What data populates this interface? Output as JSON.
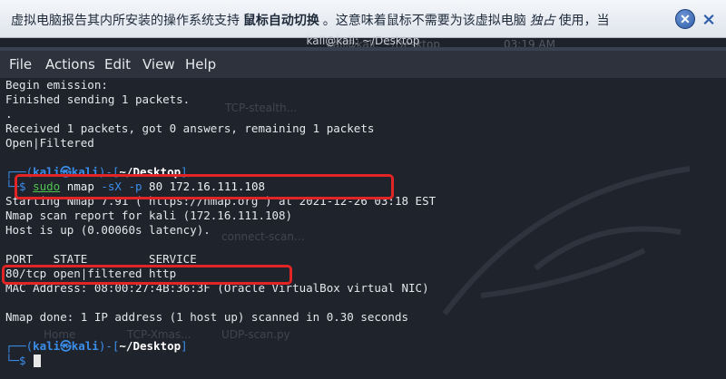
{
  "notification": {
    "text_pre": "虚拟电脑报告其内所安装的操作系统支持",
    "text_bold": "鼠标自动切换",
    "text_mid": "。这意味着鼠标不需要为该虚拟电脑",
    "text_italic": "独占",
    "text_post": "使用，当"
  },
  "desktop_panel": {
    "window_label": "kali@kali: ~/Desktop",
    "clock": "03:19 AM"
  },
  "terminal": {
    "title": "kali@kali: ~/Desktop",
    "menu": [
      "File",
      "Actions",
      "Edit",
      "View",
      "Help"
    ],
    "lines": {
      "l1": "Begin emission:",
      "l2": "Finished sending 1 packets.",
      "l3": ".",
      "l4": "Received 1 packets, got 0 answers, remaining 1 packets",
      "l5": "Open|Filtered",
      "prompt1_pre": "┌──(",
      "prompt1_user": "kali㉿kali",
      "prompt1_mid": ")-[",
      "prompt1_dir": "~/Desktop",
      "prompt1_end": "]",
      "cmd_pre": "└─$ ",
      "cmd_sudo": "sudo",
      "cmd_nmap": " nmap ",
      "cmd_flags": "-sX -p",
      "cmd_args": " 80 172.16.111.108",
      "l8": "Starting Nmap 7.91 ( https://nmap.org ) at 2021-12-26 03:18 EST",
      "l9": "Nmap scan report for kali (172.16.111.108)",
      "l10": "Host is up (0.00060s latency).",
      "l11": "",
      "l12": "PORT   STATE         SERVICE",
      "l13": "80/tcp open|filtered http",
      "l14": "MAC Address: 08:00:27:4B:36:3F (Oracle VirtualBox virtual NIC)",
      "l15": "",
      "l16": "Nmap done: 1 IP address (1 host up) scanned in 0.30 seconds",
      "prompt2_pre": "┌──(",
      "prompt2_user": "kali㉿kali",
      "prompt2_mid": ")-[",
      "prompt2_dir": "~/Desktop",
      "prompt2_end": "]",
      "cmd2_pre": "└─$ "
    }
  },
  "background_labels": {
    "tcp_stealth": "TCP-stealth...",
    "xmas_scan": "TCP-Xmas...",
    "home": "Home",
    "connect": "connect-scan...",
    "udp": "UDP-scan.py"
  },
  "colors": {
    "prompt_blue": "#3b8eea",
    "command_green": "#4ec44e",
    "highlight_red": "#e22424",
    "terminal_bg": "#1f232c"
  }
}
